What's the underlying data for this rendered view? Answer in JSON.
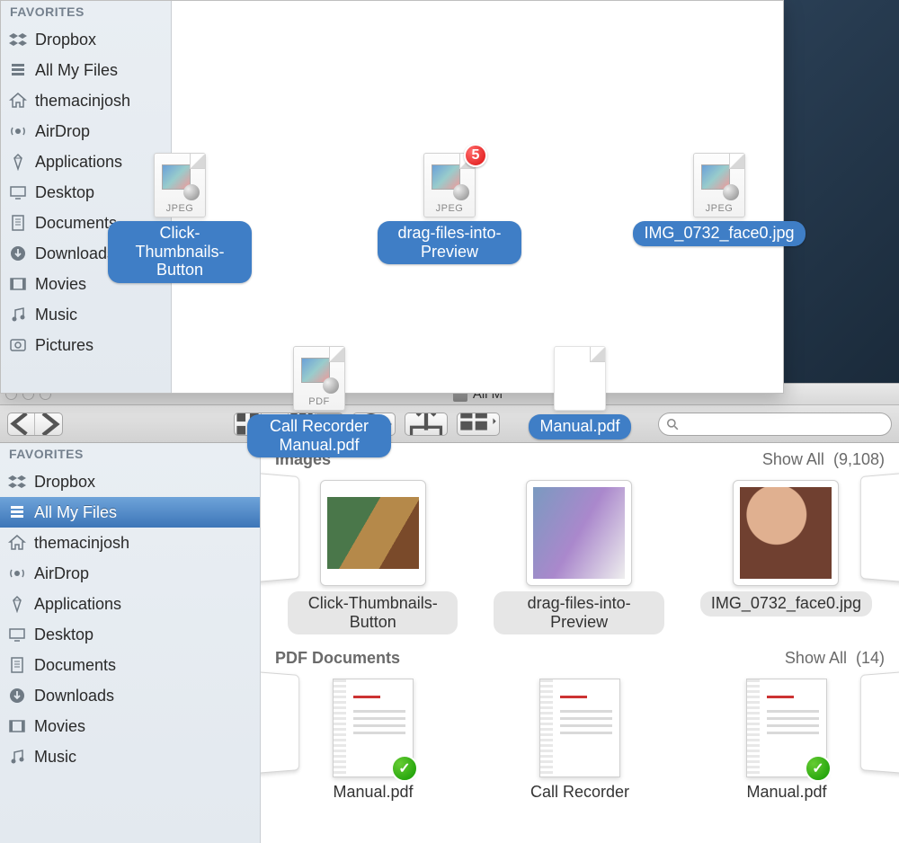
{
  "top": {
    "favorites_label": "FAVORITES",
    "items": [
      {
        "label": "Dropbox",
        "icon": "dropbox"
      },
      {
        "label": "All My Files",
        "icon": "stack"
      },
      {
        "label": "themacinjosh",
        "icon": "home"
      },
      {
        "label": "AirDrop",
        "icon": "airdrop"
      },
      {
        "label": "Applications",
        "icon": "apps"
      },
      {
        "label": "Desktop",
        "icon": "desktop"
      },
      {
        "label": "Documents",
        "icon": "docs"
      },
      {
        "label": "Downloads",
        "icon": "downloads"
      },
      {
        "label": "Movies",
        "icon": "movies"
      },
      {
        "label": "Music",
        "icon": "music"
      },
      {
        "label": "Pictures",
        "icon": "pictures"
      }
    ]
  },
  "drag": {
    "row1": [
      {
        "name": "Click-Thumbnails-Button",
        "type": "JPEG"
      },
      {
        "name": "drag-files-into-Preview",
        "type": "JPEG",
        "badge": "5"
      },
      {
        "name": "IMG_0732_face0.jpg",
        "type": "JPEG"
      }
    ],
    "row2": [
      {
        "name": "Call Recorder Manual.pdf",
        "type": "PDF"
      },
      {
        "name": "Manual.pdf",
        "type": ""
      }
    ]
  },
  "bottom": {
    "title": "All M",
    "favorites_label": "FAVORITES",
    "items": [
      {
        "label": "Dropbox",
        "icon": "dropbox"
      },
      {
        "label": "All My Files",
        "icon": "stack",
        "selected": true
      },
      {
        "label": "themacinjosh",
        "icon": "home"
      },
      {
        "label": "AirDrop",
        "icon": "airdrop"
      },
      {
        "label": "Applications",
        "icon": "apps"
      },
      {
        "label": "Desktop",
        "icon": "desktop"
      },
      {
        "label": "Documents",
        "icon": "docs"
      },
      {
        "label": "Downloads",
        "icon": "downloads"
      },
      {
        "label": "Movies",
        "icon": "movies"
      },
      {
        "label": "Music",
        "icon": "music"
      }
    ],
    "sections": {
      "images": {
        "title": "Images",
        "showall": "Show All",
        "count": "(9,108)",
        "items": [
          {
            "name": "Click-Thumbnails-Button"
          },
          {
            "name": "drag-files-into-Preview"
          },
          {
            "name": "IMG_0732_face0.jpg"
          }
        ]
      },
      "pdfs": {
        "title": "PDF Documents",
        "showall": "Show All",
        "count": "(14)",
        "items": [
          {
            "name": "Manual.pdf"
          },
          {
            "name": "Call Recorder"
          },
          {
            "name": "Manual.pdf"
          }
        ]
      }
    }
  },
  "icons": {
    "dropbox": "dropbox-icon",
    "stack": "all-files-icon",
    "home": "home-icon",
    "airdrop": "airdrop-icon",
    "apps": "applications-icon",
    "desktop": "desktop-icon",
    "docs": "documents-icon",
    "downloads": "downloads-icon",
    "movies": "movies-icon",
    "music": "music-icon",
    "pictures": "pictures-icon"
  }
}
